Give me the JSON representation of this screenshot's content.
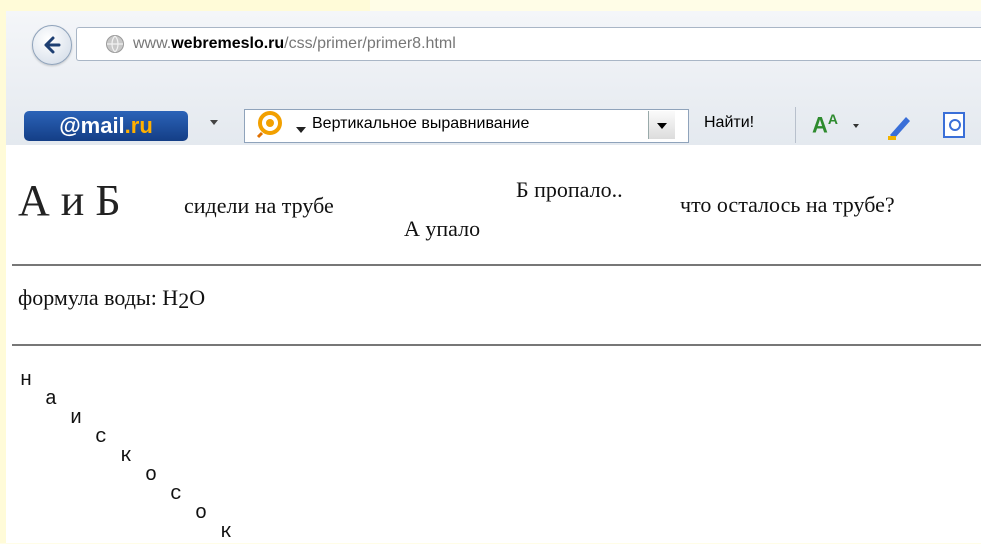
{
  "browser": {
    "url_prefix": "www.",
    "url_domain": "webremeslo.ru",
    "url_path": "/css/primer/primer8.html"
  },
  "toolbar": {
    "mail_logo_at": "@",
    "mail_logo_main": "mail",
    "mail_logo_ru": ".ru",
    "search_text": "Вертикальное выравнивание",
    "find_label": "Найти!",
    "font_icon_big": "A",
    "font_icon_small": "A"
  },
  "content": {
    "line1": {
      "big": "А и Б",
      "normal": "сидели на трубе",
      "sub": "А упало",
      "sup": "Б пропало..",
      "tail": "что осталось на трубе?"
    },
    "formula": {
      "prefix": "формула воды: H",
      "sub": "2",
      "suffix": "O"
    },
    "diagonal_letters": [
      "н",
      "а",
      "и",
      "с",
      "к",
      "о",
      "с",
      "о",
      "к"
    ]
  },
  "colors": {
    "page_bg": "#fffde7",
    "mail_logo_bg": "#1e4f9e",
    "mail_logo_ru": "#ffb000",
    "rule": "#777777"
  }
}
